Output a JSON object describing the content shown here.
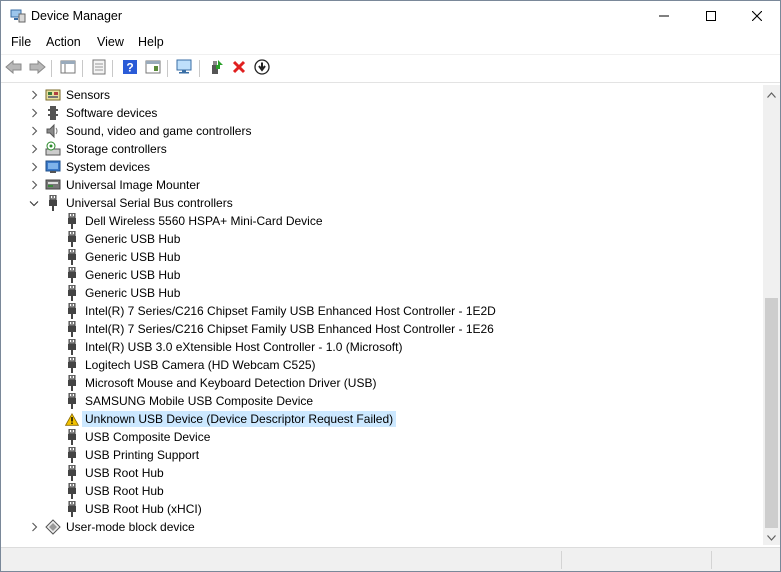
{
  "window": {
    "title": "Device Manager",
    "controls": {
      "minimize": "minimize-icon",
      "maximize": "maximize-icon",
      "close": "close-icon"
    }
  },
  "menu": {
    "items": [
      "File",
      "Action",
      "View",
      "Help"
    ]
  },
  "toolbar": {
    "buttons": [
      "back-arrow-icon",
      "forward-arrow-icon",
      "properties-list-icon",
      "update-driver-icon",
      "help-icon",
      "view-panel-icon",
      "scan-hardware-icon",
      "enable-device-icon",
      "uninstall-device-icon",
      "disable-device-icon"
    ]
  },
  "tree": {
    "categories_top": [
      {
        "label": "Sensors",
        "icon": "sensors-icon"
      },
      {
        "label": "Software devices",
        "icon": "software-device-icon"
      },
      {
        "label": "Sound, video and game controllers",
        "icon": "speaker-icon"
      },
      {
        "label": "Storage controllers",
        "icon": "storage-controller-icon"
      },
      {
        "label": "System devices",
        "icon": "system-device-icon"
      },
      {
        "label": "Universal Image Mounter",
        "icon": "image-mounter-icon"
      }
    ],
    "usb_category": {
      "label": "Universal Serial Bus controllers",
      "icon": "usb-plug-icon",
      "expanded": true
    },
    "usb_devices": [
      {
        "label": "Dell Wireless 5560 HSPA+ Mini-Card Device"
      },
      {
        "label": "Generic USB Hub"
      },
      {
        "label": "Generic USB Hub"
      },
      {
        "label": "Generic USB Hub"
      },
      {
        "label": "Generic USB Hub"
      },
      {
        "label": "Intel(R) 7 Series/C216 Chipset Family USB Enhanced Host Controller - 1E2D"
      },
      {
        "label": "Intel(R) 7 Series/C216 Chipset Family USB Enhanced Host Controller - 1E26"
      },
      {
        "label": "Intel(R) USB 3.0 eXtensible Host Controller - 1.0 (Microsoft)"
      },
      {
        "label": "Logitech USB Camera (HD Webcam C525)"
      },
      {
        "label": "Microsoft Mouse and Keyboard Detection Driver (USB)"
      },
      {
        "label": "SAMSUNG Mobile USB Composite Device"
      },
      {
        "label": "Unknown USB Device (Device Descriptor Request Failed)",
        "warning": true,
        "selected": true
      },
      {
        "label": "USB Composite Device"
      },
      {
        "label": "USB Printing Support"
      },
      {
        "label": "USB Root Hub"
      },
      {
        "label": "USB Root Hub"
      },
      {
        "label": "USB Root Hub (xHCI)"
      }
    ],
    "categories_bottom": [
      {
        "label": "User-mode block device",
        "icon": "block-device-icon"
      }
    ]
  },
  "colors": {
    "selection": "#cce8ff",
    "warning": "#f2c200",
    "delete_red": "#e02020",
    "help_blue": "#2a5bd7"
  }
}
